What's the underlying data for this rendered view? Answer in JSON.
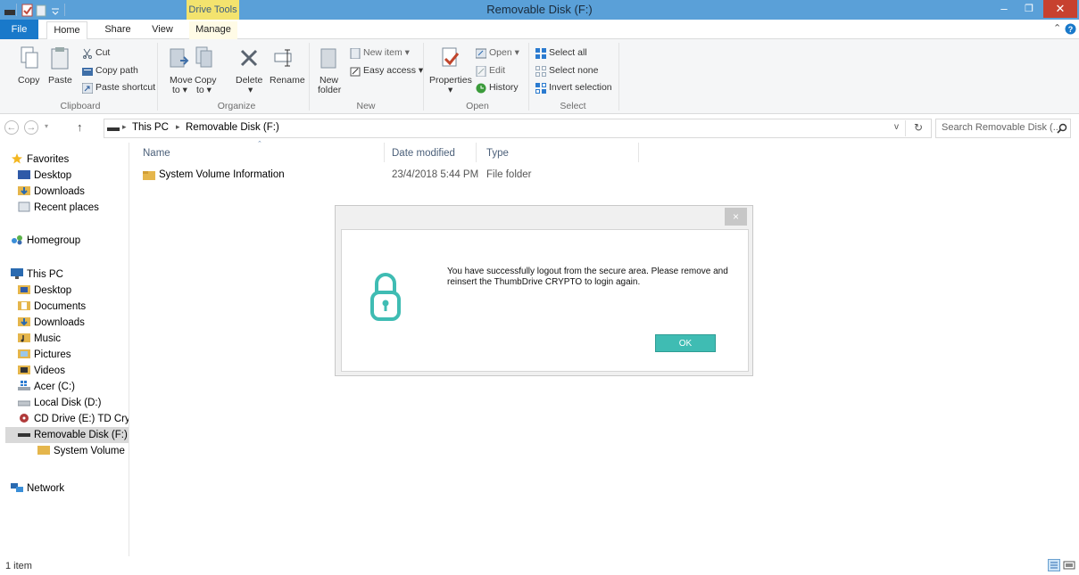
{
  "window": {
    "title": "Removable Disk (F:)",
    "contextual_tab": "Drive Tools",
    "close_glyph": "✕",
    "minimize_glyph": "–",
    "restore_glyph": "❐"
  },
  "ribbon_tabs": [
    "File",
    "Home",
    "Share",
    "View",
    "Manage"
  ],
  "ribbon": {
    "clipboard": {
      "copy": "Copy",
      "paste": "Paste",
      "cut": "Cut",
      "copy_path": "Copy path",
      "paste_shortcut": "Paste shortcut",
      "group": "Clipboard"
    },
    "organize": {
      "move_to": "Move",
      "move_to_2": "to ▾",
      "copy_to": "Copy",
      "copy_to_2": "to ▾",
      "delete": "Delete",
      "delete_arrow": "▾",
      "rename": "Rename",
      "group": "Organize"
    },
    "new": {
      "new_folder": "New",
      "new_folder_2": "folder",
      "new_item": "New item ▾",
      "easy_access": "Easy access ▾",
      "group": "New"
    },
    "open": {
      "properties": "Properties",
      "properties_arrow": "▾",
      "open": "Open ▾",
      "edit": "Edit",
      "history": "History",
      "group": "Open"
    },
    "select": {
      "select_all": "Select all",
      "select_none": "Select none",
      "invert": "Invert selection",
      "group": "Select"
    }
  },
  "address": {
    "back": "←",
    "forward": "→",
    "up": "↑",
    "crumbs": [
      "This PC",
      "Removable Disk (F:)"
    ],
    "separator": "▸",
    "dropdown": "v",
    "refresh": "↻",
    "search_placeholder": "Search Removable Disk (..."
  },
  "nav": {
    "favorites": "Favorites",
    "favorites_items": [
      "Desktop",
      "Downloads",
      "Recent places"
    ],
    "homegroup": "Homegroup",
    "this_pc": "This PC",
    "this_pc_items": [
      "Desktop",
      "Documents",
      "Downloads",
      "Music",
      "Pictures",
      "Videos",
      "Acer (C:)",
      "Local Disk (D:)",
      "CD Drive (E:) TD Cry",
      "Removable Disk (F:)"
    ],
    "sub_item": "System Volume Ir",
    "network": "Network"
  },
  "file_list": {
    "columns": [
      "Name",
      "Date modified",
      "Type"
    ],
    "rows": [
      {
        "name": "System Volume Information",
        "date": "23/4/2018 5:44 PM",
        "type": "File folder"
      }
    ]
  },
  "dialog": {
    "close": "×",
    "message": "You have successfully logout from the secure area. Please remove and reinsert the ThumbDrive CRYPTO to login again.",
    "ok": "OK",
    "accent": "#3fbcb3"
  },
  "status": {
    "items": "1 item"
  },
  "colors": {
    "titlebar": "#5aa0d8",
    "file_tab": "#1979ca",
    "drive_tools": "#f3e36e",
    "close": "#c7412f"
  }
}
